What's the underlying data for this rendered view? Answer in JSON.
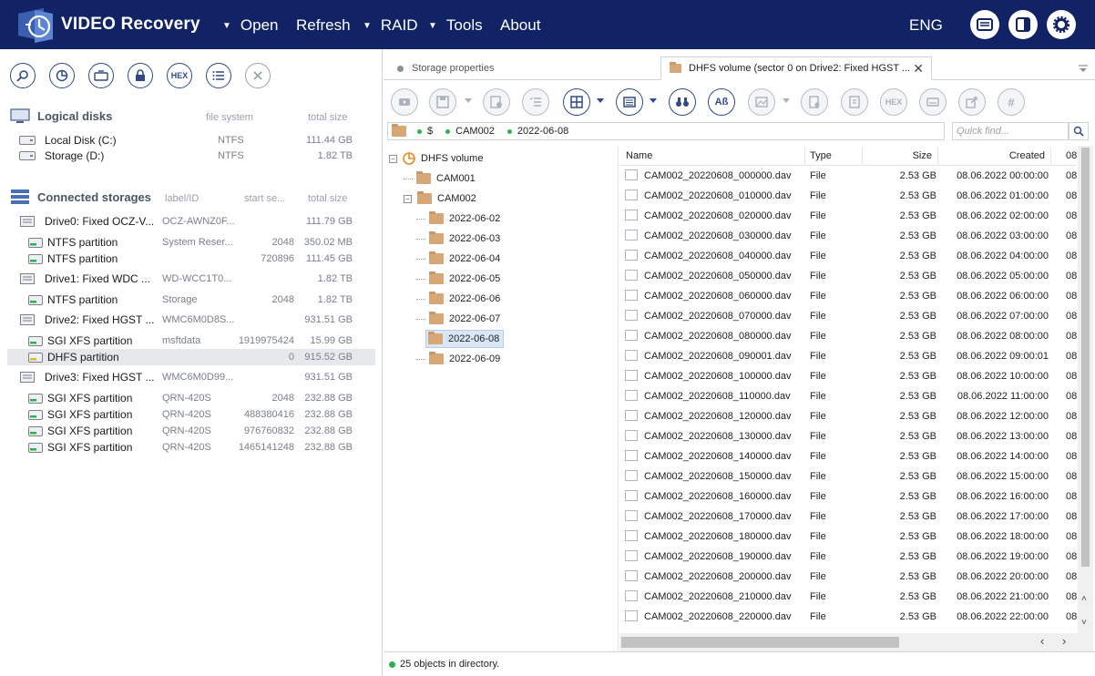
{
  "app": {
    "title": "VIDEO Recovery",
    "menu": [
      {
        "label": "Open",
        "caret": true
      },
      {
        "label": "Refresh",
        "caret": false
      },
      {
        "label": "RAID",
        "caret": true
      },
      {
        "label": "Tools",
        "caret": true
      },
      {
        "label": "About",
        "caret": false
      }
    ],
    "language": "ENG"
  },
  "left": {
    "toolbar": [
      "search-icon",
      "chart-icon",
      "drive-copy-icon",
      "lock-icon",
      "HEX",
      "list-icon",
      "close-icon"
    ],
    "hex_label": "HEX",
    "logical": {
      "title": "Logical disks",
      "col_fs": "file system",
      "col_size": "total size",
      "rows": [
        {
          "name": "Local Disk (C:)",
          "fs": "NTFS",
          "size": "111.44 GB"
        },
        {
          "name": "Storage (D:)",
          "fs": "NTFS",
          "size": "1.82 TB"
        }
      ]
    },
    "connected": {
      "title": "Connected storages",
      "col_label": "label/ID",
      "col_start": "start se...",
      "col_size": "total size",
      "rows": [
        {
          "kind": "drive",
          "name": "Drive0: Fixed OCZ-V...",
          "label": "OCZ-AWNZ0F...",
          "start": "",
          "size": "111.79 GB"
        },
        {
          "kind": "part",
          "name": "NTFS partition",
          "label": "System Reser...",
          "start": "2048",
          "size": "350.02 MB"
        },
        {
          "kind": "part",
          "name": "NTFS partition",
          "label": "",
          "start": "720896",
          "size": "111.45 GB"
        },
        {
          "kind": "drive",
          "name": "Drive1: Fixed WDC ...",
          "label": "WD-WCC1T0...",
          "start": "",
          "size": "1.82 TB"
        },
        {
          "kind": "part",
          "name": "NTFS partition",
          "label": "Storage",
          "start": "2048",
          "size": "1.82 TB"
        },
        {
          "kind": "drive",
          "name": "Drive2: Fixed HGST ...",
          "label": "WMC6M0D8S...",
          "start": "",
          "size": "931.51 GB"
        },
        {
          "kind": "part",
          "name": "SGI XFS partition",
          "label": "msftdata",
          "start": "1919975424",
          "size": "15.99 GB"
        },
        {
          "kind": "part-sel",
          "name": "DHFS partition",
          "label": "",
          "start": "0",
          "size": "915.52 GB"
        },
        {
          "kind": "drive",
          "name": "Drive3: Fixed HGST ...",
          "label": "WMC6M0D99...",
          "start": "",
          "size": "931.51 GB"
        },
        {
          "kind": "part",
          "name": "SGI XFS partition",
          "label": "QRN-420S",
          "start": "2048",
          "size": "232.88 GB"
        },
        {
          "kind": "part",
          "name": "SGI XFS partition",
          "label": "QRN-420S",
          "start": "488380416",
          "size": "232.88 GB"
        },
        {
          "kind": "part",
          "name": "SGI XFS partition",
          "label": "QRN-420S",
          "start": "976760832",
          "size": "232.88 GB"
        },
        {
          "kind": "part",
          "name": "SGI XFS partition",
          "label": "QRN-420S",
          "start": "1465141248",
          "size": "232.88 GB"
        }
      ]
    }
  },
  "right": {
    "tabs": [
      {
        "label": "Storage properties"
      },
      {
        "label": "DHFS volume (sector 0 on Drive2: Fixed HGST ..."
      }
    ],
    "hex_label": "HEX",
    "path": {
      "root": "$",
      "seg1": "CAM002",
      "seg2": "2022-06-08"
    },
    "quick_find_placeholder": "Quick find...",
    "tree": {
      "root": "DHFS volume",
      "cam001": "CAM001",
      "cam002": "CAM002",
      "dates": [
        "2022-06-02",
        "2022-06-03",
        "2022-06-04",
        "2022-06-05",
        "2022-06-06",
        "2022-06-07",
        "2022-06-08",
        "2022-06-09"
      ],
      "selected": "2022-06-08"
    },
    "columns": {
      "name": "Name",
      "type": "Type",
      "size": "Size",
      "created": "Created",
      "extra": "08"
    },
    "files": [
      {
        "name": "CAM002_20220608_000000.dav",
        "type": "File",
        "size": "2.53 GB",
        "created": "08.06.2022 00:00:00",
        "extra": "08"
      },
      {
        "name": "CAM002_20220608_010000.dav",
        "type": "File",
        "size": "2.53 GB",
        "created": "08.06.2022 01:00:00",
        "extra": "08"
      },
      {
        "name": "CAM002_20220608_020000.dav",
        "type": "File",
        "size": "2.53 GB",
        "created": "08.06.2022 02:00:00",
        "extra": "08"
      },
      {
        "name": "CAM002_20220608_030000.dav",
        "type": "File",
        "size": "2.53 GB",
        "created": "08.06.2022 03:00:00",
        "extra": "08"
      },
      {
        "name": "CAM002_20220608_040000.dav",
        "type": "File",
        "size": "2.53 GB",
        "created": "08.06.2022 04:00:00",
        "extra": "08"
      },
      {
        "name": "CAM002_20220608_050000.dav",
        "type": "File",
        "size": "2.53 GB",
        "created": "08.06.2022 05:00:00",
        "extra": "08"
      },
      {
        "name": "CAM002_20220608_060000.dav",
        "type": "File",
        "size": "2.53 GB",
        "created": "08.06.2022 06:00:00",
        "extra": "08"
      },
      {
        "name": "CAM002_20220608_070000.dav",
        "type": "File",
        "size": "2.53 GB",
        "created": "08.06.2022 07:00:00",
        "extra": "08"
      },
      {
        "name": "CAM002_20220608_080000.dav",
        "type": "File",
        "size": "2.53 GB",
        "created": "08.06.2022 08:00:00",
        "extra": "08"
      },
      {
        "name": "CAM002_20220608_090001.dav",
        "type": "File",
        "size": "2.53 GB",
        "created": "08.06.2022 09:00:01",
        "extra": "08"
      },
      {
        "name": "CAM002_20220608_100000.dav",
        "type": "File",
        "size": "2.53 GB",
        "created": "08.06.2022 10:00:00",
        "extra": "08"
      },
      {
        "name": "CAM002_20220608_110000.dav",
        "type": "File",
        "size": "2.53 GB",
        "created": "08.06.2022 11:00:00",
        "extra": "08"
      },
      {
        "name": "CAM002_20220608_120000.dav",
        "type": "File",
        "size": "2.53 GB",
        "created": "08.06.2022 12:00:00",
        "extra": "08"
      },
      {
        "name": "CAM002_20220608_130000.dav",
        "type": "File",
        "size": "2.53 GB",
        "created": "08.06.2022 13:00:00",
        "extra": "08"
      },
      {
        "name": "CAM002_20220608_140000.dav",
        "type": "File",
        "size": "2.53 GB",
        "created": "08.06.2022 14:00:00",
        "extra": "08"
      },
      {
        "name": "CAM002_20220608_150000.dav",
        "type": "File",
        "size": "2.53 GB",
        "created": "08.06.2022 15:00:00",
        "extra": "08"
      },
      {
        "name": "CAM002_20220608_160000.dav",
        "type": "File",
        "size": "2.53 GB",
        "created": "08.06.2022 16:00:00",
        "extra": "08"
      },
      {
        "name": "CAM002_20220608_170000.dav",
        "type": "File",
        "size": "2.53 GB",
        "created": "08.06.2022 17:00:00",
        "extra": "08"
      },
      {
        "name": "CAM002_20220608_180000.dav",
        "type": "File",
        "size": "2.53 GB",
        "created": "08.06.2022 18:00:00",
        "extra": "08"
      },
      {
        "name": "CAM002_20220608_190000.dav",
        "type": "File",
        "size": "2.53 GB",
        "created": "08.06.2022 19:00:00",
        "extra": "08"
      },
      {
        "name": "CAM002_20220608_200000.dav",
        "type": "File",
        "size": "2.53 GB",
        "created": "08.06.2022 20:00:00",
        "extra": "08"
      },
      {
        "name": "CAM002_20220608_210000.dav",
        "type": "File",
        "size": "2.53 GB",
        "created": "08.06.2022 21:00:00",
        "extra": "08"
      },
      {
        "name": "CAM002_20220608_220000.dav",
        "type": "File",
        "size": "2.53 GB",
        "created": "08.06.2022 22:00:00",
        "extra": "08"
      }
    ],
    "status": "25 objects in directory."
  },
  "colors": {
    "topbar": "#112364",
    "accent": "#2f4a87",
    "selected_row": "#e6e8ec",
    "tree_selected": "#d9e6f5",
    "status_dot": "#2bb24c"
  }
}
